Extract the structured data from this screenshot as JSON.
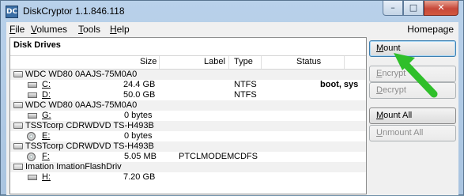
{
  "window": {
    "title": "DiskCryptor 1.1.846.118",
    "icon_text": "DC",
    "caption_buttons": {
      "minimize": "–",
      "maximize": "□",
      "close": "✕"
    }
  },
  "menu": {
    "items": [
      {
        "label": "File",
        "accel": "F",
        "rest": "ile"
      },
      {
        "label": "Volumes",
        "accel": "V",
        "rest": "olumes"
      },
      {
        "label": "Tools",
        "accel": "T",
        "rest": "ools"
      },
      {
        "label": "Help",
        "accel": "H",
        "rest": "elp"
      }
    ],
    "homepage": "Homepage"
  },
  "panel": {
    "title": "Disk Drives",
    "columns": {
      "size": "Size",
      "label": "Label",
      "type": "Type",
      "status": "Status"
    }
  },
  "rows": [
    {
      "kind": "disk",
      "name": "WDC WD80 0AAJS-75M0A0"
    },
    {
      "kind": "volume",
      "name": "C:",
      "size": "24.4 GB",
      "label": "",
      "type": "NTFS",
      "status": "boot, sys"
    },
    {
      "kind": "volume",
      "name": "D:",
      "size": "50.0 GB",
      "label": "",
      "type": "NTFS",
      "status": ""
    },
    {
      "kind": "disk",
      "name": "WDC WD80 0AAJS-75M0A0"
    },
    {
      "kind": "volume",
      "name": "G:",
      "size": "0 bytes",
      "label": "",
      "type": "",
      "status": ""
    },
    {
      "kind": "disk",
      "name": "TSSTcorp CDRWDVD TS-H493B"
    },
    {
      "kind": "cd",
      "name": "E:",
      "size": "0 bytes",
      "label": "",
      "type": "",
      "status": ""
    },
    {
      "kind": "disk",
      "name": "TSSTcorp CDRWDVD TS-H493B"
    },
    {
      "kind": "cd",
      "name": "F:",
      "size": "5.05 MB",
      "label": "PTCLMODEM",
      "type": "CDFS",
      "status": ""
    },
    {
      "kind": "usb",
      "name": "Imation ImationFlashDriv"
    },
    {
      "kind": "volume",
      "name": "H:",
      "size": "7.20 GB",
      "label": "",
      "type": "",
      "status": ""
    }
  ],
  "buttons": {
    "mount": {
      "label": "Mount",
      "accel": "M",
      "rest": "ount"
    },
    "encrypt": {
      "label": "Encrypt",
      "accel": "E",
      "rest": "ncrypt"
    },
    "decrypt": {
      "label": "Decrypt",
      "accel": "D",
      "rest": "ecrypt"
    },
    "mount_all": {
      "label": "Mount All",
      "accel": "M",
      "rest": "ount All"
    },
    "unmount_all": {
      "label": "Unmount All",
      "accel": "U",
      "rest": "nmount All"
    }
  },
  "colors": {
    "accent_arrow": "#2fbf2a",
    "close_button": "#c7483a"
  }
}
